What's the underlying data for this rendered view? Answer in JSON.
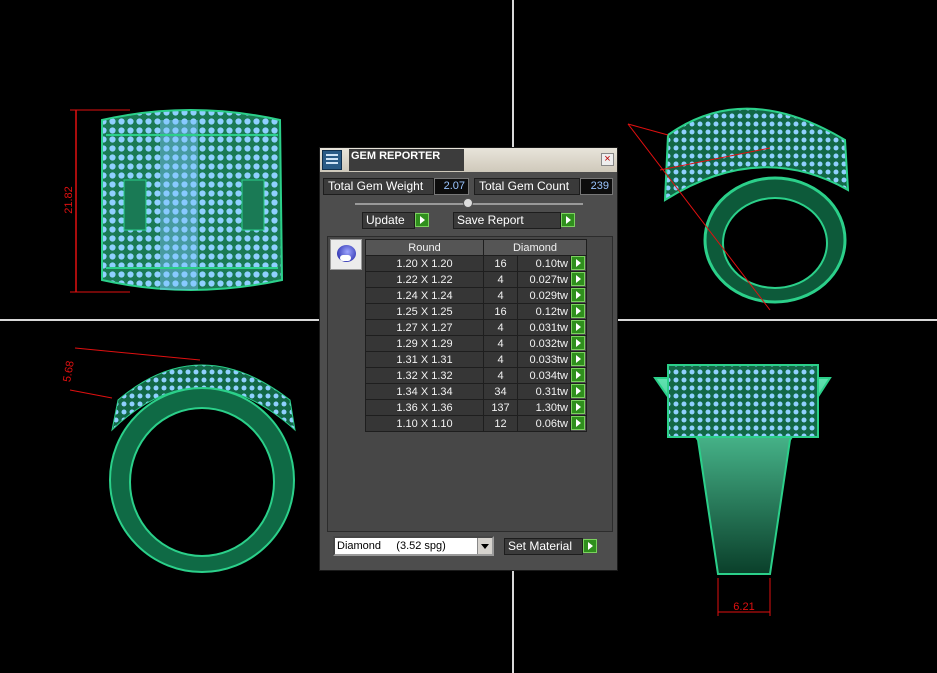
{
  "viewport": {
    "dimension_top": "21.82",
    "dimension_side": "5.68",
    "dimension_bottom": "6.21"
  },
  "window": {
    "title": "GEM REPORTER",
    "close_label": "×"
  },
  "totals": {
    "weight_label": "Total Gem Weight",
    "weight_value": "2.07",
    "count_label": "Total Gem Count",
    "count_value": "239"
  },
  "actions": {
    "update_label": "Update",
    "save_label": "Save Report",
    "set_material_label": "Set Material"
  },
  "table": {
    "col_shape": "Round",
    "col_material": "Diamond",
    "rows": [
      {
        "size": "1.20 X 1.20",
        "count": "16",
        "carat": "0.10tw"
      },
      {
        "size": "1.22 X 1.22",
        "count": "4",
        "carat": "0.027tw"
      },
      {
        "size": "1.24 X 1.24",
        "count": "4",
        "carat": "0.029tw"
      },
      {
        "size": "1.25 X 1.25",
        "count": "16",
        "carat": "0.12tw"
      },
      {
        "size": "1.27 X 1.27",
        "count": "4",
        "carat": "0.031tw"
      },
      {
        "size": "1.29 X 1.29",
        "count": "4",
        "carat": "0.032tw"
      },
      {
        "size": "1.31 X 1.31",
        "count": "4",
        "carat": "0.033tw"
      },
      {
        "size": "1.32 X 1.32",
        "count": "4",
        "carat": "0.034tw"
      },
      {
        "size": "1.34 X 1.34",
        "count": "34",
        "carat": "0.31tw"
      },
      {
        "size": "1.36 X 1.36",
        "count": "137",
        "carat": "1.30tw"
      },
      {
        "size": "1.10 X 1.10",
        "count": "12",
        "carat": "0.06tw"
      }
    ]
  },
  "material": {
    "selected": "Diamond     (3.52 spg)"
  },
  "colors": {
    "ring_green": "#1f8a5a",
    "gem_blue": "#8fd0ff",
    "dimension_red": "#e01010",
    "go_green": "#2f8f1d"
  }
}
